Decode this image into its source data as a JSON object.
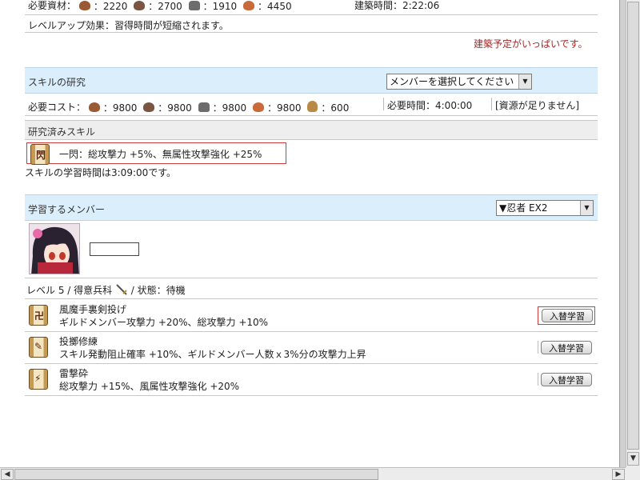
{
  "top": {
    "required_label": "必要資材",
    "wood": "2220",
    "stone": "2700",
    "iron": "1910",
    "food": "4450",
    "build_time": "建築時間：2:22:06",
    "levelup_effect": "レベルアップ効果：習得時間が短縮されます。",
    "queue_full": "建築予定がいっぱいです。"
  },
  "research": {
    "title": "スキルの研究",
    "member_select": "メンバーを選択してください",
    "cost_label": "必要コスト：",
    "wood": "9800",
    "stone": "9800",
    "iron": "9800",
    "food": "9800",
    "gold": "600",
    "required_time": "必要時間：4:00:00",
    "insufficient": "[資源が足りません]"
  },
  "researched": {
    "title": "研究済みスキル",
    "skill": "一閃：総攻撃力 +5%、無属性攻撃強化 +25%",
    "study_time": "スキルの学習時間は3:09:00です。"
  },
  "learning": {
    "title": "学習するメンバー",
    "member_select": "▼忍者 EX2",
    "status_line_pre": "レベル 5 / 得意兵科",
    "status_line_post": "/ 状態：待機"
  },
  "skills": [
    {
      "name": "風魔手裏剣投げ",
      "desc": "ギルドメンバー攻撃力 +20%、総攻撃力 +10%",
      "button": "入替学習"
    },
    {
      "name": "投擲修練",
      "desc": "スキル発動阻止確率 +10%、ギルドメンバー人数ｘ3%分の攻撃力上昇",
      "button": "入替学習"
    },
    {
      "name": "雷撃砕",
      "desc": "総攻撃力 +15%、風属性攻撃強化 +20%",
      "button": "入替学習"
    }
  ],
  "colors": {
    "section_header": "#dbeefc",
    "warning_text": "#a52a2a",
    "highlight_border": "#d23b3b"
  },
  "icons": [
    "wood-icon",
    "stone-icon",
    "iron-icon",
    "food-icon",
    "gold-bag-icon",
    "scroll-icon",
    "sword-icon",
    "avatar"
  ]
}
